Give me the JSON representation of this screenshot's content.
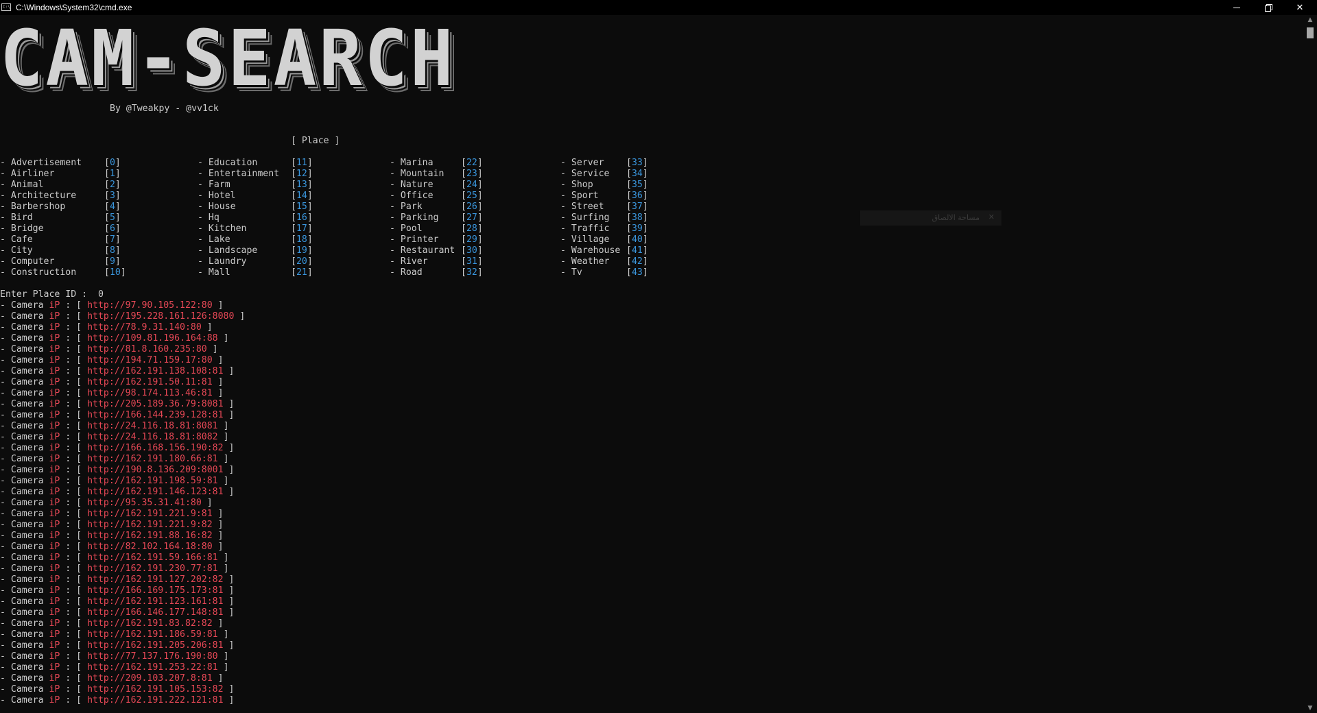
{
  "window": {
    "title": "C:\\Windows\\System32\\cmd.exe",
    "icon_text": "C:\\",
    "minimize_icon": "minimize-icon",
    "restore_icon": "restore-icon",
    "close_icon": "close-icon",
    "close_glyph": "✕"
  },
  "banner": {
    "text": "CAM-SEARCH",
    "byline": "By @Tweakpy - @vv1ck"
  },
  "place_header": "[ Place ]",
  "places": [
    [
      {
        "label": "- Advertisement",
        "id": "0"
      },
      {
        "label": "- Airliner",
        "id": "1"
      },
      {
        "label": "- Animal",
        "id": "2"
      },
      {
        "label": "- Architecture",
        "id": "3"
      },
      {
        "label": "- Barbershop",
        "id": "4"
      },
      {
        "label": "- Bird",
        "id": "5"
      },
      {
        "label": "- Bridge",
        "id": "6"
      },
      {
        "label": "- Cafe",
        "id": "7"
      },
      {
        "label": "- City",
        "id": "8"
      },
      {
        "label": "- Computer",
        "id": "9"
      },
      {
        "label": "- Construction",
        "id": "10"
      }
    ],
    [
      {
        "label": "- Education",
        "id": "11"
      },
      {
        "label": "- Entertainment",
        "id": "12"
      },
      {
        "label": "- Farm",
        "id": "13"
      },
      {
        "label": "- Hotel",
        "id": "14"
      },
      {
        "label": "- House",
        "id": "15"
      },
      {
        "label": "- Hq",
        "id": "16"
      },
      {
        "label": "- Kitchen",
        "id": "17"
      },
      {
        "label": "- Lake",
        "id": "18"
      },
      {
        "label": "- Landscape",
        "id": "19"
      },
      {
        "label": "- Laundry",
        "id": "20"
      },
      {
        "label": "- Mall",
        "id": "21"
      }
    ],
    [
      {
        "label": "- Marina",
        "id": "22"
      },
      {
        "label": "- Mountain",
        "id": "23"
      },
      {
        "label": "- Nature",
        "id": "24"
      },
      {
        "label": "- Office",
        "id": "25"
      },
      {
        "label": "- Park",
        "id": "26"
      },
      {
        "label": "- Parking",
        "id": "27"
      },
      {
        "label": "- Pool",
        "id": "28"
      },
      {
        "label": "- Printer",
        "id": "29"
      },
      {
        "label": "- Restaurant",
        "id": "30"
      },
      {
        "label": "- River",
        "id": "31"
      },
      {
        "label": "- Road",
        "id": "32"
      }
    ],
    [
      {
        "label": "- Server",
        "id": "33"
      },
      {
        "label": "- Service",
        "id": "34"
      },
      {
        "label": "- Shop",
        "id": "35"
      },
      {
        "label": "- Sport",
        "id": "36"
      },
      {
        "label": "- Street",
        "id": "37"
      },
      {
        "label": "- Surfing",
        "id": "38"
      },
      {
        "label": "- Traffic",
        "id": "39"
      },
      {
        "label": "- Village",
        "id": "40"
      },
      {
        "label": "- Warehouse",
        "id": "41"
      },
      {
        "label": "- Weather",
        "id": "42"
      },
      {
        "label": "- Tv",
        "id": "43"
      }
    ]
  ],
  "prompt": {
    "text": "Enter Place ID :",
    "value": "0"
  },
  "camera_row": {
    "prefix": "- Camera ",
    "ip_word": "iP",
    "sep": " : [ ",
    "suffix": " ]"
  },
  "cameras": [
    "http://97.90.105.122:80",
    "http://195.228.161.126:8080",
    "http://78.9.31.140:80",
    "http://109.81.196.164:88",
    "http://81.8.160.235:80",
    "http://194.71.159.17:80",
    "http://162.191.138.108:81",
    "http://162.191.50.11:81",
    "http://98.174.113.46:81",
    "http://205.189.36.79:8081",
    "http://166.144.239.128:81",
    "http://24.116.18.81:8081",
    "http://24.116.18.81:8082",
    "http://166.168.156.190:82",
    "http://162.191.180.66:81",
    "http://190.8.136.209:8001",
    "http://162.191.198.59:81",
    "http://162.191.146.123:81",
    "http://95.35.31.41:80",
    "http://162.191.221.9:81",
    "http://162.191.221.9:82",
    "http://162.191.88.16:82",
    "http://82.102.164.18:80",
    "http://162.191.59.166:81",
    "http://162.191.230.77:81",
    "http://162.191.127.202:82",
    "http://166.169.175.173:81",
    "http://162.191.123.161:81",
    "http://166.146.177.148:81",
    "http://162.191.83.82:82",
    "http://162.191.186.59:81",
    "http://162.191.205.206:81",
    "http://77.137.176.190:80",
    "http://162.191.253.22:81",
    "http://209.103.207.8:81",
    "http://162.191.105.153:82",
    "http://162.191.222.121:81"
  ],
  "overlay": {
    "text": "مساحة الالصاق",
    "close_glyph": "✕"
  },
  "scrollbar": {
    "up_glyph": "▲",
    "down_glyph": "▼"
  },
  "colors": {
    "background": "#0c0c0c",
    "text": "#cccccc",
    "id_blue": "#3a96dd",
    "url_red": "#e74856"
  }
}
